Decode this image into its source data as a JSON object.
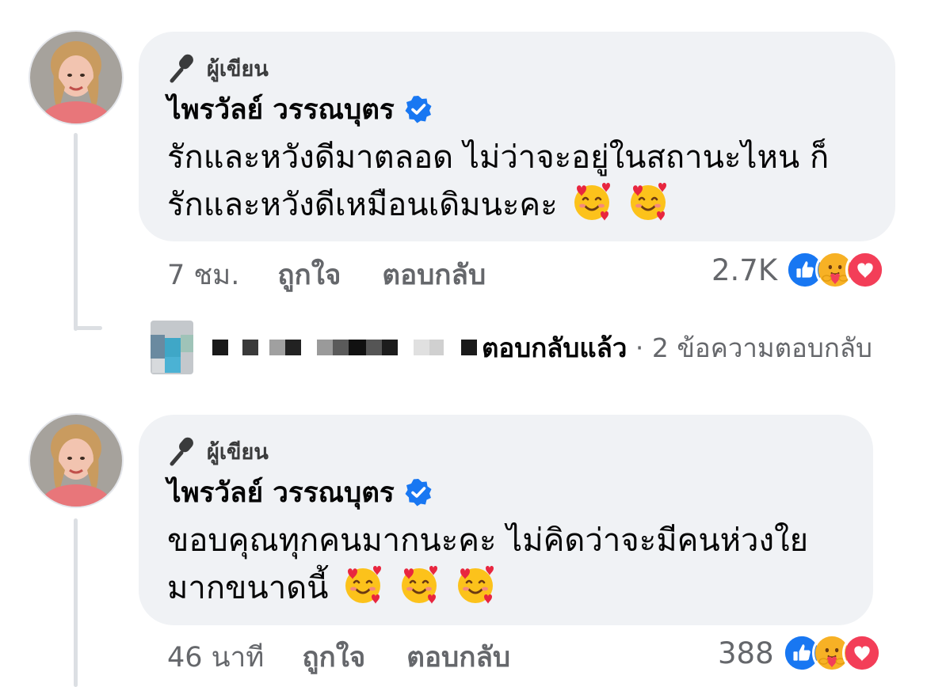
{
  "comments": [
    {
      "author_badge": "ผู้เขียน",
      "name": "ไพรวัลย์ วรรณบุตร",
      "text_line1": "รักและหวังดีมาตลอด ไม่ว่าจะอยู่ในสถานะไหน ก็",
      "text_line2": "รักและหวังดีเหมือนเดิมนะคะ",
      "emoji_icons": [
        "smiling-face-with-hearts-icon",
        "smiling-face-with-hearts-icon"
      ],
      "time": "7 ชม.",
      "like_label": "ถูกใจ",
      "reply_label": "ตอบกลับ",
      "reaction_count": "2.7K",
      "reaction_icons": [
        "like-icon",
        "care-icon",
        "love-icon"
      ]
    },
    {
      "author_badge": "ผู้เขียน",
      "name": "ไพรวัลย์ วรรณบุตร",
      "text_line1": "ขอบคุณทุกคนมากนะคะ ไม่คิดว่าจะมีคนห่วงใย",
      "text_line2": "มากขนาดนี้",
      "emoji_icons": [
        "smiling-face-with-hearts-icon",
        "smiling-face-with-hearts-icon",
        "smiling-face-with-hearts-icon"
      ],
      "time": "46 นาที",
      "like_label": "ถูกใจ",
      "reply_label": "ตอบกลับ",
      "reaction_count": "388",
      "reaction_icons": [
        "like-icon",
        "care-icon",
        "love-icon"
      ]
    }
  ],
  "reply_summary": {
    "replied_text": "ตอบกลับแล้ว",
    "separator": "·",
    "count_text": "2 ข้อความตอบกลับ"
  },
  "colors": {
    "bubble": "#f0f2f5",
    "verified": "#1877f2",
    "secondary_text": "#65676b",
    "like": "#1877f2",
    "love": "#f33e58",
    "care": "#f7b125"
  }
}
